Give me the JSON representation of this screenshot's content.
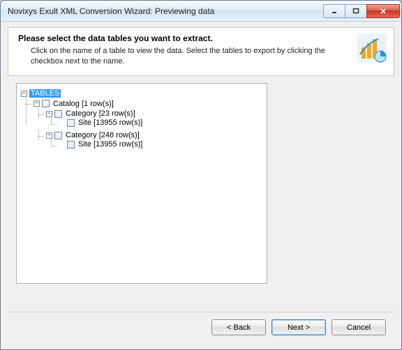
{
  "window": {
    "title": "Novixys Exult XML Conversion Wizard: Previewing data"
  },
  "header": {
    "main": "Please select the data tables you want to extract.",
    "sub": "Click on the name of a table to view the data. Select the tables to export by clicking the checkbox next to the name."
  },
  "tree": {
    "root": "TABLES",
    "n_catalog": "Catalog [1 row(s)]",
    "n_cat1": "Category [23 row(s)]",
    "n_site1": "Site [13955 row(s)]",
    "n_cat2": "Category [248 row(s)]",
    "n_site2": "Site [13955 row(s)]"
  },
  "buttons": {
    "back": "< Back",
    "next": "Next >",
    "cancel": "Cancel"
  }
}
